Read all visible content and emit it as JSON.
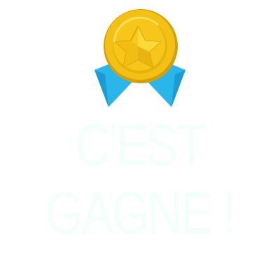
{
  "screen": {
    "title_line_1": "C'EST",
    "title_line_2": "GAGNE !"
  },
  "medal": {
    "icon": "gold-star-medal-icon",
    "ribbon_color": "#29b6ea",
    "ribbon_shadow_color": "#1590c8",
    "medal_color": "#f6c514",
    "medal_rim_color": "#d9a106",
    "star_color": "#f7c81c"
  },
  "colors": {
    "background": "#ffffff",
    "title_text": "#f3fffb"
  }
}
